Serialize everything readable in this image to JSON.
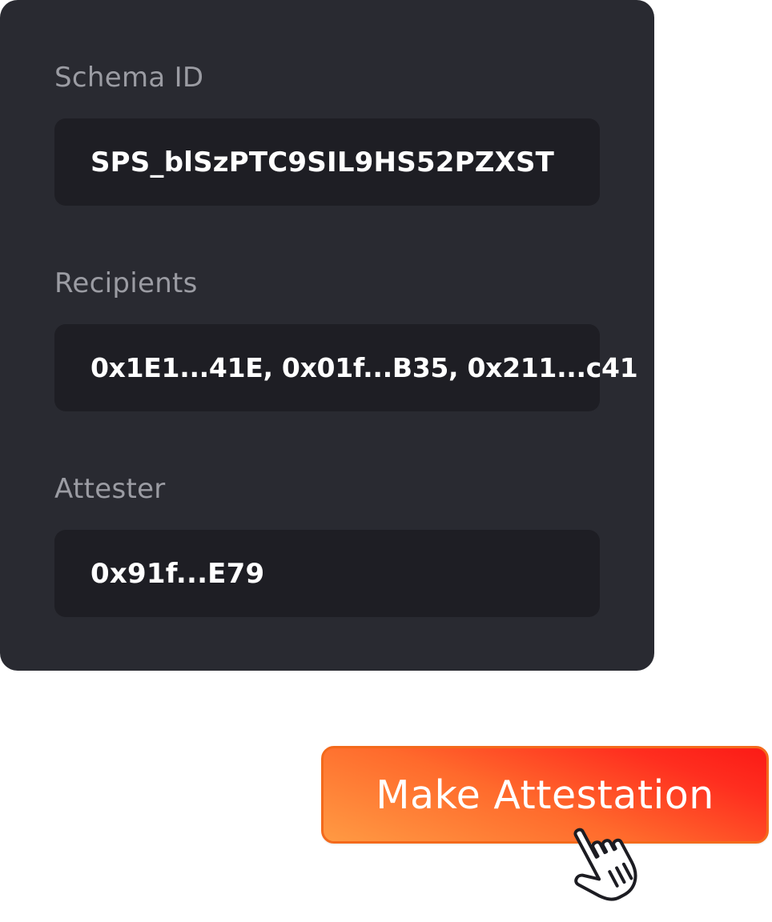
{
  "fields": {
    "schema_id": {
      "label": "Schema ID",
      "value": "SPS_blSzPTC9SIL9HS52PZXST"
    },
    "recipients": {
      "label": "Recipients",
      "value": "0x1E1...41E, 0x01f...B35, 0x211...c41"
    },
    "attester": {
      "label": "Attester",
      "value": "0x91f...E79"
    }
  },
  "action": {
    "label": "Make Attestation"
  },
  "cursor": {
    "icon": "hand-pointer-icon"
  },
  "colors": {
    "card_background": "#292a31",
    "field_background": "#1e1e24",
    "label_text": "#9b9ca3",
    "button_gradient_start": "#ff9a43",
    "button_gradient_end": "#fb1a16"
  }
}
